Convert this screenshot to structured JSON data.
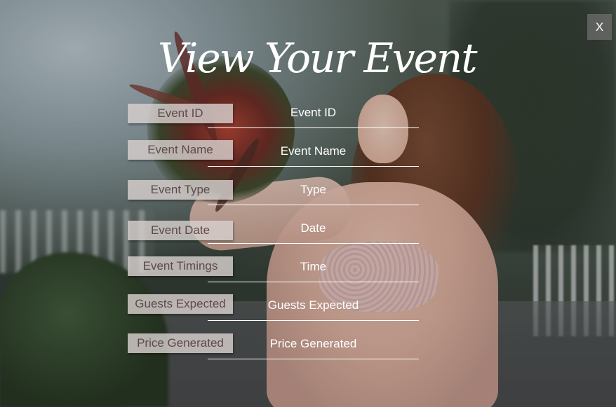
{
  "window": {
    "title": "View Your Event",
    "close_label": "X"
  },
  "form": {
    "rows": [
      {
        "label": "Event ID",
        "value": "Event ID"
      },
      {
        "label": "Event Name",
        "value": "Event Name"
      },
      {
        "label": "Event Type",
        "value": "Type"
      },
      {
        "label": "Event Date",
        "value": "Date"
      },
      {
        "label": "Event Timings",
        "value": "Time"
      },
      {
        "label": "Guests Expected",
        "value": "Guests Expected"
      },
      {
        "label": "Price Generated",
        "value": "Price Generated"
      }
    ]
  },
  "colors": {
    "label_background": "#d7d0cd",
    "label_text": "#5e4a4d",
    "value_text": "#ffffff",
    "close_background": "#6e6e6e"
  },
  "icons": {
    "close": "close-icon"
  }
}
